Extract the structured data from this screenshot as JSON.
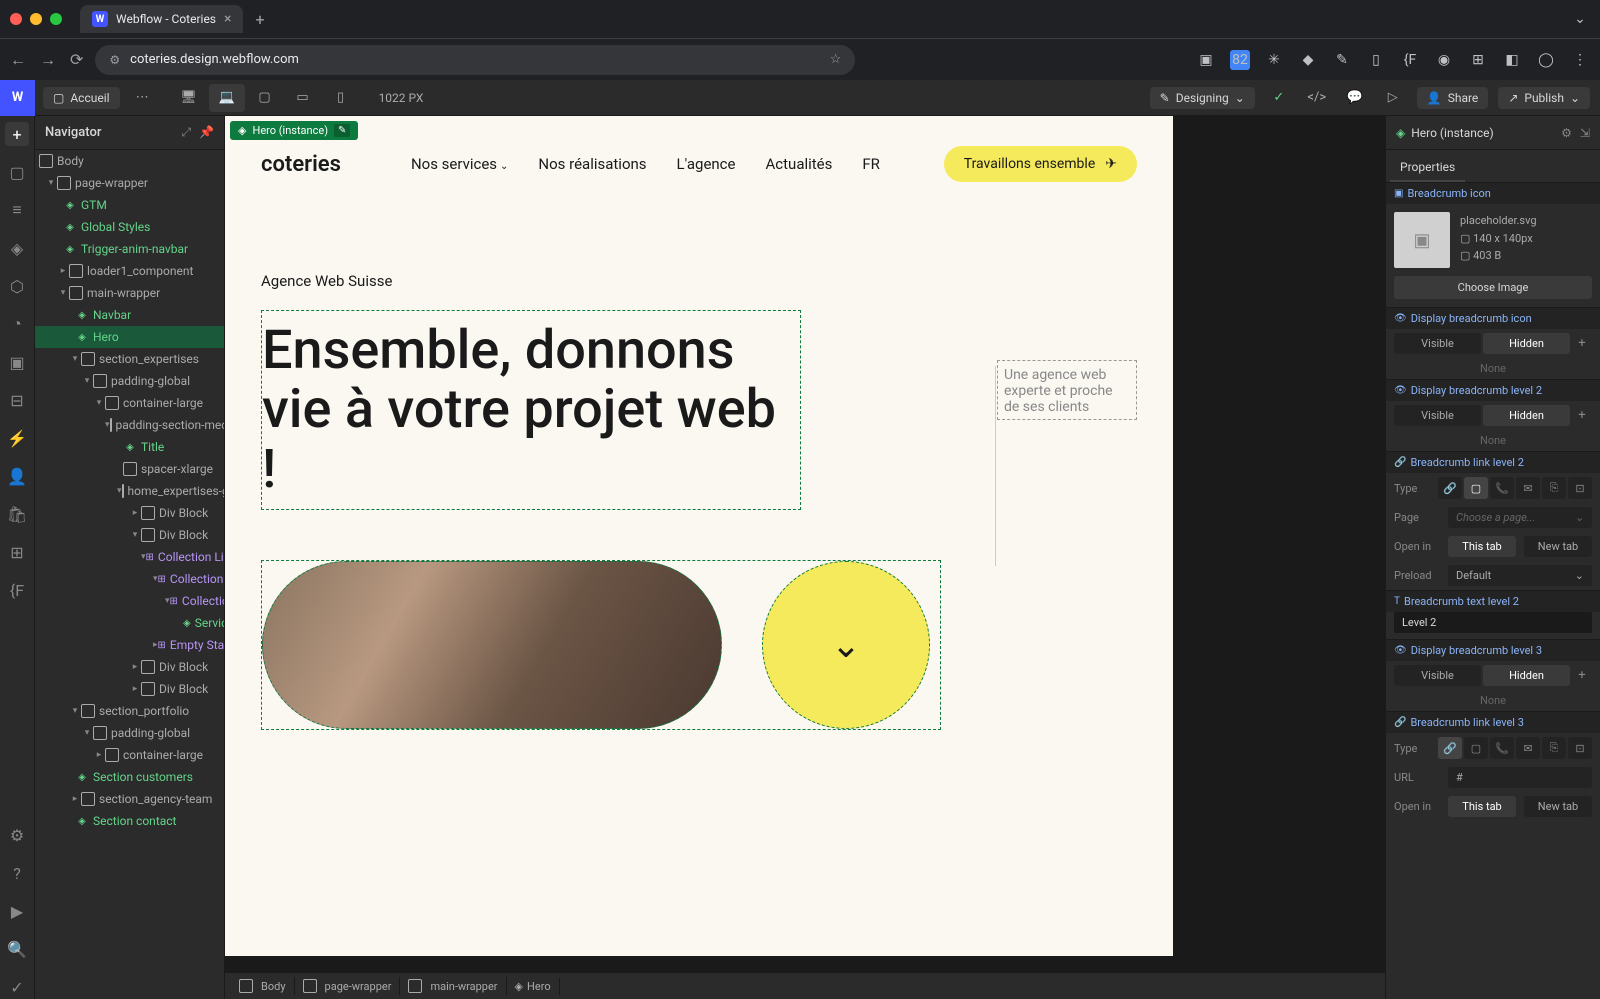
{
  "browser": {
    "tab_title": "Webflow - Coteries",
    "url": "coteries.design.webflow.com"
  },
  "topbar": {
    "home": "Accueil",
    "canvas_size": "1022 PX",
    "designing": "Designing",
    "share": "Share",
    "publish": "Publish"
  },
  "navigator": {
    "title": "Navigator",
    "selection_badge": "Hero (instance)",
    "tree": {
      "body": "Body",
      "page_wrapper": "page-wrapper",
      "gtm": "GTM",
      "global_styles": "Global Styles",
      "trigger_anim": "Trigger-anim-navbar",
      "loader1": "loader1_component",
      "main_wrapper": "main-wrapper",
      "navbar": "Navbar",
      "hero": "Hero",
      "section_expertises": "section_expertises",
      "padding_global": "padding-global",
      "container_large": "container-large",
      "padding_section_med": "padding-section-med",
      "title": "Title",
      "spacer_xlarge": "spacer-xlarge",
      "home_expertises_g": "home_expertises-g",
      "div_block": "Div Block",
      "collection_list": "Collection List",
      "collection_li": "Collection Li",
      "collection": "Collection",
      "service": "Service",
      "empty_state": "Empty State",
      "section_portfolio": "section_portfolio",
      "section_customers": "Section customers",
      "section_agency_team": "section_agency-team",
      "section_contact": "Section contact"
    }
  },
  "site": {
    "logo": "coteries",
    "nav": {
      "services": "Nos services",
      "realisations": "Nos réalisations",
      "agence": "L'agence",
      "actualites": "Actualités",
      "lang": "FR"
    },
    "cta": "Travaillons ensemble",
    "eyebrow": "Agence Web Suisse",
    "hero_title": "Ensemble, donnons vie à votre projet web !",
    "hero_side": "Une agence web experte et proche de ses clients"
  },
  "breadcrumb": {
    "body": "Body",
    "pw": "page-wrapper",
    "mw": "main-wrapper",
    "hero": "Hero"
  },
  "panel": {
    "header": "Hero (instance)",
    "tab": "Properties",
    "sections": {
      "bc_icon": "Breadcrumb icon",
      "disp_bc_icon": "Display breadcrumb icon",
      "disp_bc_l2": "Display breadcrumb level 2",
      "bc_link_l2": "Breadcrumb link level 2",
      "bc_text_l2": "Breadcrumb text level 2",
      "disp_bc_l3": "Display breadcrumb level 3",
      "bc_link_l3": "Breadcrumb link level 3"
    },
    "img": {
      "name": "placeholder.svg",
      "dims": "140 x 140px",
      "size": "403 B",
      "choose": "Choose Image"
    },
    "toggle": {
      "visible": "Visible",
      "hidden": "Hidden"
    },
    "none": "None",
    "link": {
      "type": "Type",
      "page": "Page",
      "page_ph": "Choose a page...",
      "open_in": "Open in",
      "this_tab": "This tab",
      "new_tab": "New tab",
      "preload": "Preload",
      "default": "Default",
      "url": "URL",
      "hash": "#"
    },
    "text_l2": "Level 2"
  }
}
